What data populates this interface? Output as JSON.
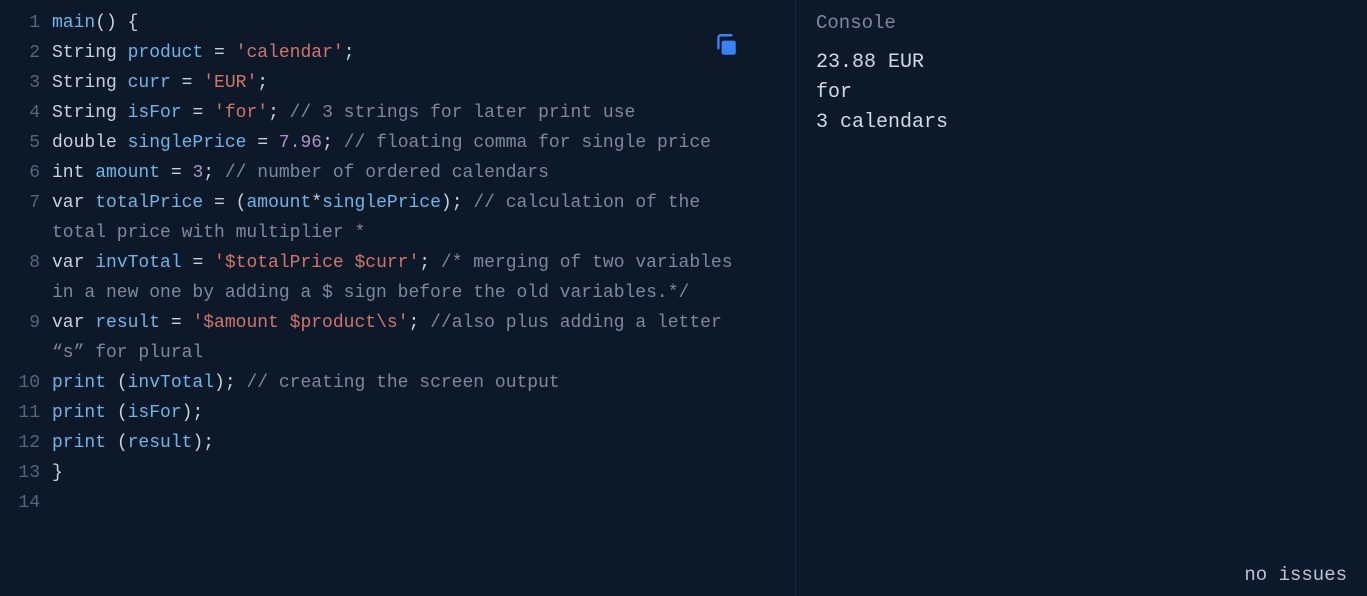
{
  "editor": {
    "lines": [
      {
        "num": "1",
        "tokens": [
          {
            "t": "main",
            "c": "tok-func"
          },
          {
            "t": "() {",
            "c": "tok-punct"
          }
        ]
      },
      {
        "num": "2",
        "tokens": [
          {
            "t": "String ",
            "c": "tok-type"
          },
          {
            "t": "product",
            "c": "tok-var"
          },
          {
            "t": " = ",
            "c": "tok-op"
          },
          {
            "t": "'calendar'",
            "c": "tok-str"
          },
          {
            "t": ";",
            "c": "tok-punct"
          }
        ]
      },
      {
        "num": "3",
        "tokens": [
          {
            "t": "String ",
            "c": "tok-type"
          },
          {
            "t": "curr",
            "c": "tok-var"
          },
          {
            "t": " = ",
            "c": "tok-op"
          },
          {
            "t": "'EUR'",
            "c": "tok-str"
          },
          {
            "t": ";",
            "c": "tok-punct"
          }
        ]
      },
      {
        "num": "4",
        "tokens": [
          {
            "t": "String ",
            "c": "tok-type"
          },
          {
            "t": "isFor",
            "c": "tok-var"
          },
          {
            "t": " = ",
            "c": "tok-op"
          },
          {
            "t": "'for'",
            "c": "tok-str"
          },
          {
            "t": "; ",
            "c": "tok-punct"
          },
          {
            "t": "// 3 strings for later print use",
            "c": "tok-comment"
          }
        ]
      },
      {
        "num": "5",
        "tokens": [
          {
            "t": "double ",
            "c": "tok-type"
          },
          {
            "t": "singlePrice",
            "c": "tok-var"
          },
          {
            "t": " = ",
            "c": "tok-op"
          },
          {
            "t": "7.96",
            "c": "tok-num"
          },
          {
            "t": "; ",
            "c": "tok-punct"
          },
          {
            "t": "// floating comma for single price",
            "c": "tok-comment"
          }
        ]
      },
      {
        "num": "6",
        "tokens": [
          {
            "t": "int ",
            "c": "tok-type"
          },
          {
            "t": "amount",
            "c": "tok-var"
          },
          {
            "t": " = ",
            "c": "tok-op"
          },
          {
            "t": "3",
            "c": "tok-num"
          },
          {
            "t": "; ",
            "c": "tok-punct"
          },
          {
            "t": "// number of ordered calendars",
            "c": "tok-comment"
          }
        ]
      },
      {
        "num": "7",
        "tokens": [
          {
            "t": "var ",
            "c": "tok-type"
          },
          {
            "t": "totalPrice",
            "c": "tok-var"
          },
          {
            "t": " = (",
            "c": "tok-op"
          },
          {
            "t": "amount",
            "c": "tok-var"
          },
          {
            "t": "*",
            "c": "tok-op"
          },
          {
            "t": "singlePrice",
            "c": "tok-var"
          },
          {
            "t": "); ",
            "c": "tok-punct"
          },
          {
            "t": "// calculation of the total price with multiplier *",
            "c": "tok-comment"
          }
        ]
      },
      {
        "num": "8",
        "tokens": [
          {
            "t": "var ",
            "c": "tok-type"
          },
          {
            "t": "invTotal",
            "c": "tok-var"
          },
          {
            "t": " = ",
            "c": "tok-op"
          },
          {
            "t": "'$totalPrice $curr'",
            "c": "tok-str"
          },
          {
            "t": "; ",
            "c": "tok-punct"
          },
          {
            "t": "/* merging of two variables in a new one by adding a $ sign before the old variables.*/",
            "c": "tok-comment"
          }
        ]
      },
      {
        "num": "9",
        "tokens": [
          {
            "t": "var ",
            "c": "tok-type"
          },
          {
            "t": "result",
            "c": "tok-var"
          },
          {
            "t": " = ",
            "c": "tok-op"
          },
          {
            "t": "'$amount $product",
            "c": "tok-str"
          },
          {
            "t": "\\s",
            "c": "tok-escape"
          },
          {
            "t": "'",
            "c": "tok-str"
          },
          {
            "t": "; ",
            "c": "tok-punct"
          },
          {
            "t": "//also plus adding a letter “s” for plural",
            "c": "tok-comment"
          }
        ]
      },
      {
        "num": "10",
        "tokens": [
          {
            "t": "print ",
            "c": "tok-func"
          },
          {
            "t": "(",
            "c": "tok-punct"
          },
          {
            "t": "invTotal",
            "c": "tok-var"
          },
          {
            "t": "); ",
            "c": "tok-punct"
          },
          {
            "t": "// creating the screen output",
            "c": "tok-comment"
          }
        ]
      },
      {
        "num": "11",
        "tokens": [
          {
            "t": "print ",
            "c": "tok-func"
          },
          {
            "t": "(",
            "c": "tok-punct"
          },
          {
            "t": "isFor",
            "c": "tok-var"
          },
          {
            "t": ");",
            "c": "tok-punct"
          }
        ]
      },
      {
        "num": "12",
        "tokens": [
          {
            "t": "print ",
            "c": "tok-func"
          },
          {
            "t": "(",
            "c": "tok-punct"
          },
          {
            "t": "result",
            "c": "tok-var"
          },
          {
            "t": ");",
            "c": "tok-punct"
          }
        ]
      },
      {
        "num": "13",
        "tokens": [
          {
            "t": "}",
            "c": "tok-punct"
          }
        ]
      },
      {
        "num": "14",
        "tokens": []
      }
    ]
  },
  "console": {
    "title": "Console",
    "output": [
      "23.88 EUR",
      "for",
      "3 calendars"
    ],
    "status": "no issues"
  }
}
